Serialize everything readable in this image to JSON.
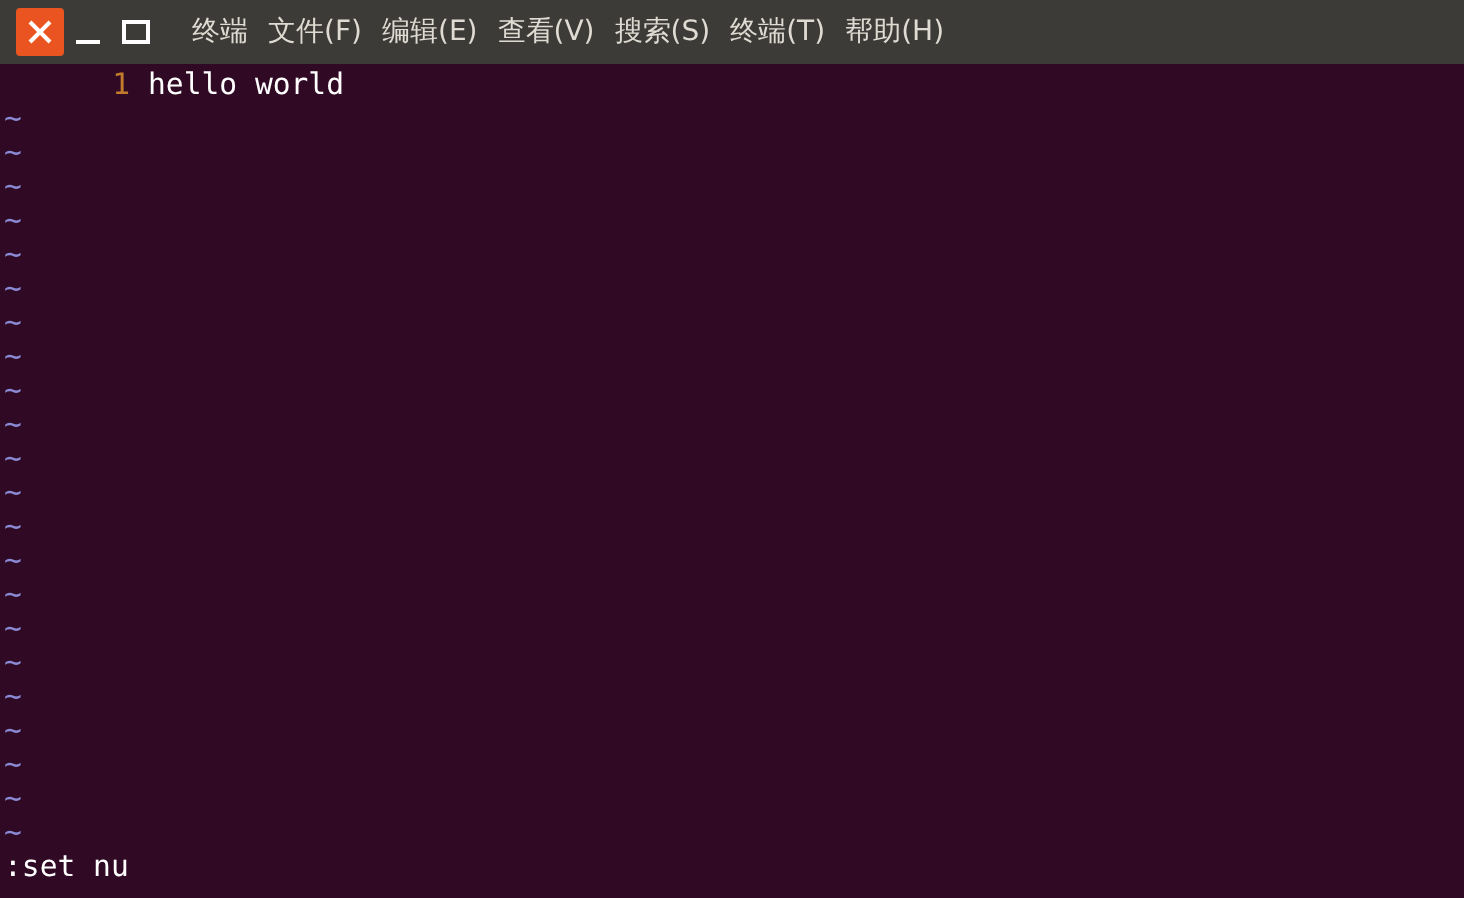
{
  "menu": [
    "终端",
    "文件(F)",
    "编辑(E)",
    "查看(V)",
    "搜索(S)",
    "终端(T)",
    "帮助(H)"
  ],
  "buffer_lines": [
    {
      "number": "1",
      "text": "hello world"
    }
  ],
  "empty_lines": [
    "~",
    "~",
    "~",
    "~",
    "~",
    "~",
    "~",
    "~",
    "~",
    "~",
    "~",
    "~",
    "~",
    "~",
    "~",
    "~",
    "~",
    "~",
    "~",
    "~",
    "~",
    "~"
  ],
  "command_line": ":set nu"
}
